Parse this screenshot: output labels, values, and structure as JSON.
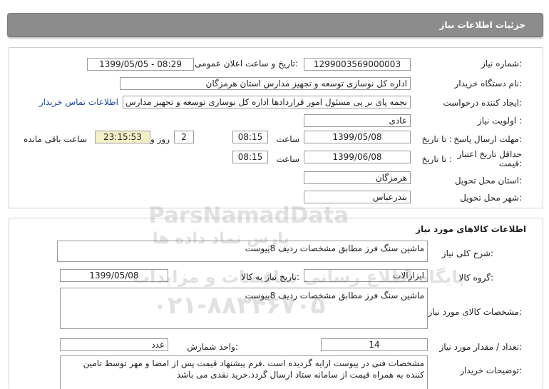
{
  "header": {
    "title": "جزئیات اطلاعات نیاز"
  },
  "info": {
    "need_number_label": "شماره نیاز:",
    "need_number": "1299003569000003",
    "announce_label": "تاریخ و ساعت اعلان عمومی:",
    "announce_value": "1399/05/05 - 08:29",
    "buyer_label": "نام دستگاه خریدار:",
    "buyer_value": "اداره کل نوسازی توسعه و تجهیز مدارس استان هرمزگان",
    "creator_label": "ایجاد کننده درخواست:",
    "creator_value": "نجمه  پای بر پی مسئول امور قراردادها اداره کل نوسازی توسعه و تجهیز مدارس ا",
    "contact_link": "اطلاعات تماس خریدار",
    "priority_label": "اولویت نیاز :",
    "priority_value": "عادی",
    "reply_deadline_label": "مهلت ارسال پاسخ:",
    "to_date_label": "تا تاریخ :",
    "reply_date": "1399/05/08",
    "time_label": "ساعت",
    "reply_time": "08:15",
    "days_value": "2",
    "days_label": "روز و",
    "remaining_time": "23:15:53",
    "remaining_label": "ساعت باقی مانده",
    "validity_label_1": "حداقل تاریخ اعتبار",
    "validity_label_2": "قیمت:",
    "validity_date": "1399/06/08",
    "validity_time": "08:15",
    "province_label": "استان محل تحویل:",
    "province_value": "هرمزگان",
    "city_label": "شهر محل تحویل:",
    "city_value": "بندرعباس"
  },
  "goods": {
    "section_title": "اطلاعات کالاهای مورد نیاز",
    "summary_label": "شرح کلی نیاز:",
    "summary_value": "ماشین سنگ فرز مطابق مشخصات ردیف 8پیوست",
    "group_label": "گروه کالا:",
    "group_value": "ابزارآلات",
    "need_date_label": "تاریخ نیاز به کالا:",
    "need_date_value": "1399/05/08",
    "specs_label": "مشخصات کالای مورد نیاز:",
    "specs_value": "ماشین سنگ فرز مطابق مشخصات ردیف 8پیوست",
    "qty_label": "تعداد / مقدار مورد نیاز:",
    "qty_value": "14",
    "unit_label": "واحد شمارش:",
    "unit_value": "عدد",
    "buyer_notes_label": "توضیحات خریدار:",
    "buyer_notes_value": "مشخصات فنی  در پیوست ارایه گردیده است .فرم پیشنهاد قیمت پس از امضا و مهر توسط تامین کننده به همراه قیمت از سامانه ستاد ارسال گردد.خرید نقدی می باشد"
  },
  "watermark": {
    "brand": "ParsNamadData",
    "fa_line": "پایگاه اطلاع رسانی مناقصات و مزایدات",
    "phone": "۰۲۱-۸۸۳۴۶۷۰۵",
    "fa_brand": "پارس نماد داده ها"
  }
}
